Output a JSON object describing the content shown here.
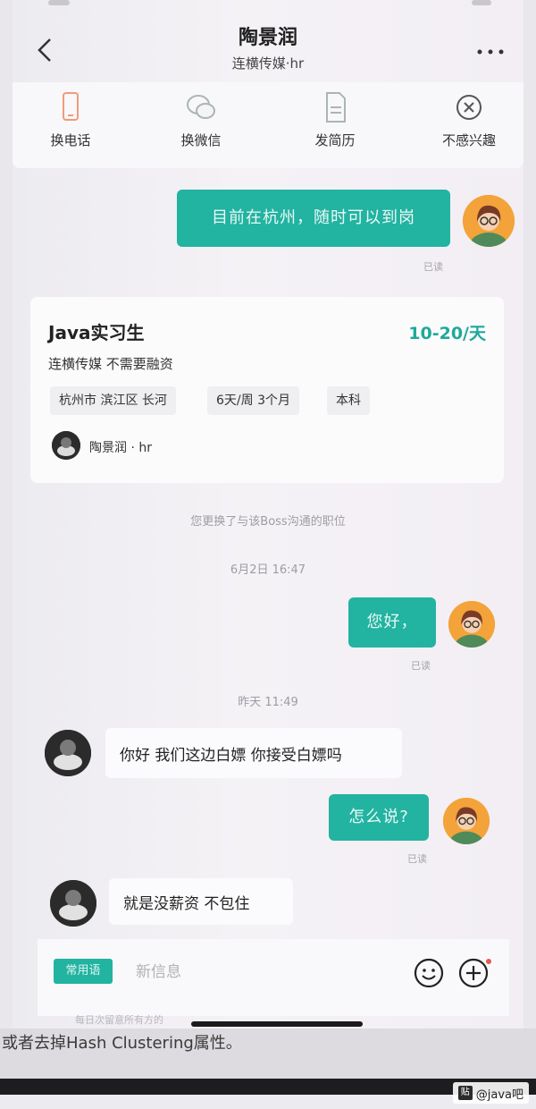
{
  "header": {
    "title": "陶景润",
    "subtitle": "连横传媒·hr"
  },
  "actions": [
    {
      "label": "换电话",
      "icon": "phone-icon"
    },
    {
      "label": "换微信",
      "icon": "wechat-icon"
    },
    {
      "label": "发简历",
      "icon": "resume-icon"
    },
    {
      "label": "不感兴趣",
      "icon": "not-interested-icon"
    }
  ],
  "messages": {
    "m1": {
      "text": "目前在杭州，随时可以到岗",
      "status": "已读"
    },
    "m2": {
      "text": "您好，",
      "status": "已读"
    },
    "m3": {
      "text": "你好 我们这边白嫖 你接受白嫖吗"
    },
    "m4": {
      "text": "怎么说?",
      "status": "已读"
    },
    "m5": {
      "text": "就是没薪资 不包住"
    }
  },
  "job_card": {
    "title": "Java实习生",
    "salary": "10-20/天",
    "company": "连横传媒 不需要融资",
    "tags": [
      "杭州市 滨江区 长河",
      "6天/周 3个月",
      "本科"
    ],
    "recruiter": "陶景润 · hr"
  },
  "system": {
    "switch_notice": "您更换了与该Boss沟通的职位",
    "time1": "6月2日 16:47",
    "time2": "昨天 11:49"
  },
  "input_bar": {
    "quick_label": "常用语",
    "placeholder": "新信息",
    "hint": "每日次留意所有方的"
  },
  "background_text": "或者去掉Hash Clustering属性。",
  "watermark": {
    "icon": "贴",
    "text": "@java吧"
  },
  "colors": {
    "accent": "#22b3a1",
    "salary": "#1fa99a",
    "avatar_bg": "#f3a339"
  }
}
